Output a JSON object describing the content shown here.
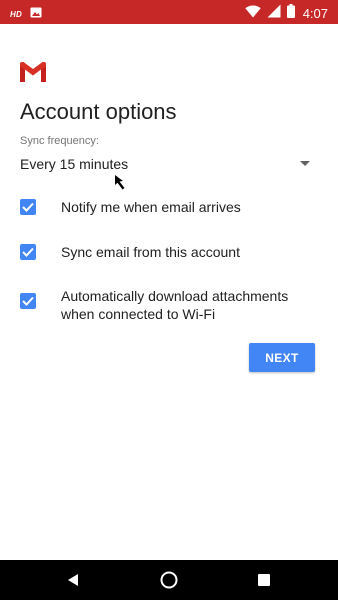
{
  "status_bar": {
    "hd_label": "HD",
    "time": "4:07",
    "left_icons": [
      "hd-icon",
      "image-icon"
    ],
    "right_icons": [
      "wifi-icon",
      "signal-icon",
      "battery-icon"
    ],
    "color": "#c62828"
  },
  "header": {
    "logo": "gmail-logo-icon",
    "title": "Account options"
  },
  "sync": {
    "label": "Sync frequency:",
    "value": "Every 15 minutes"
  },
  "options": [
    {
      "label": "Notify me when email arrives",
      "checked": true
    },
    {
      "label": "Sync email from this account",
      "checked": true
    },
    {
      "label": "Automatically download attachments when connected to Wi-Fi",
      "checked": true
    }
  ],
  "actions": {
    "next_label": "NEXT",
    "accent": "#4285f4"
  },
  "nav_bar": {
    "icons": [
      "back-icon",
      "home-icon",
      "recents-icon"
    ]
  }
}
